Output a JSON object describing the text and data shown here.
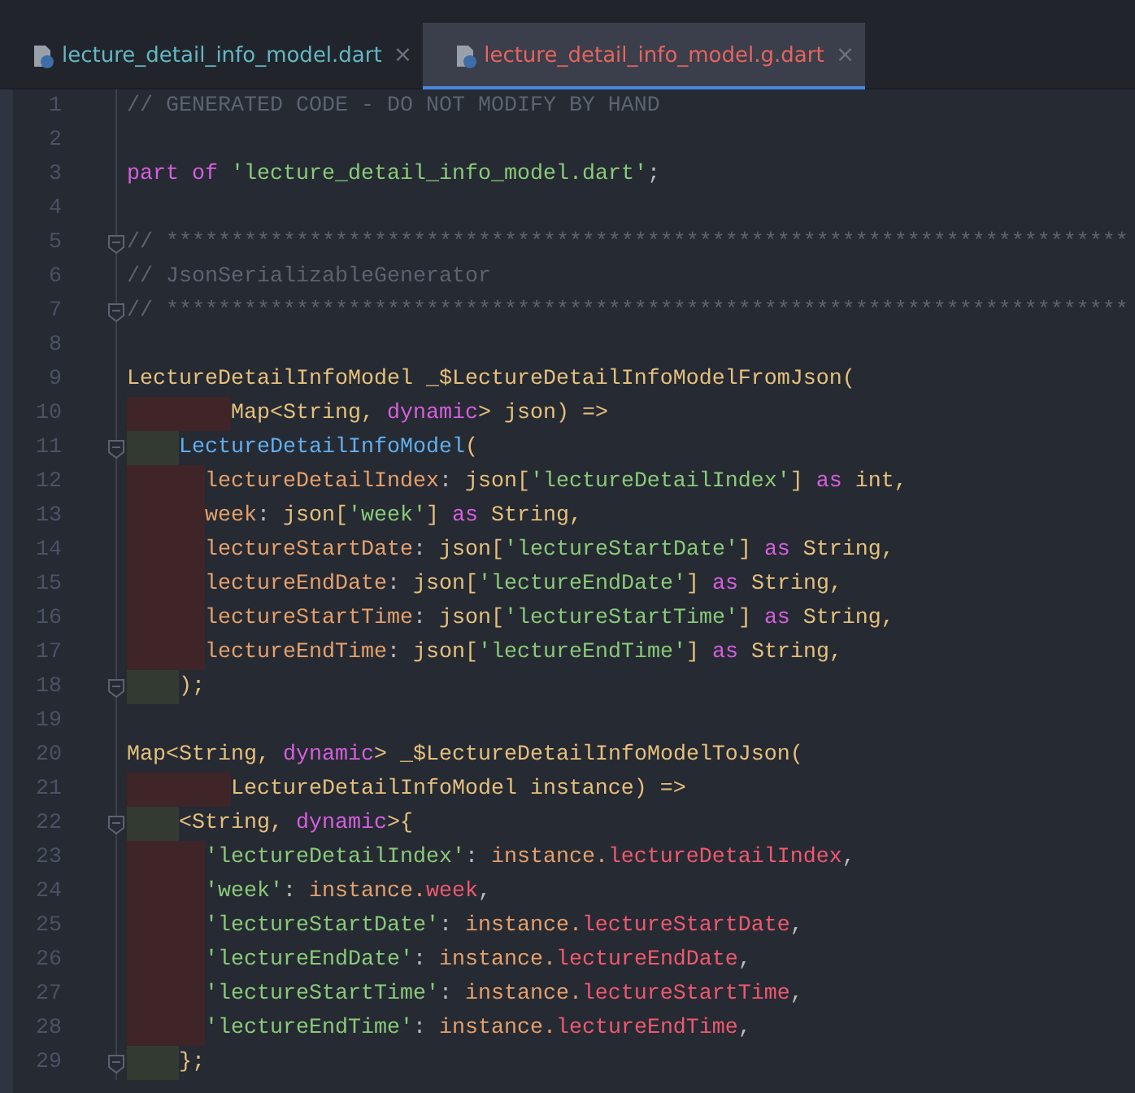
{
  "tabs": [
    {
      "label": "lecture_detail_info_model.dart",
      "close": "×",
      "selected": false,
      "color": "#62b8c4"
    },
    {
      "label": "lecture_detail_info_model.g.dart",
      "close": "×",
      "selected": true,
      "color": "#e8645e"
    }
  ],
  "editor": {
    "lines": [
      {
        "n": "1",
        "tokens": [
          {
            "kind": "comment",
            "t": "// GENERATED CODE - DO NOT MODIFY BY HAND"
          }
        ]
      },
      {
        "n": "2"
      },
      {
        "n": "3",
        "tokens": [
          {
            "kind": "keyword",
            "t": "part of "
          },
          {
            "kind": "string",
            "t": "'lecture_detail_info_model.dart'"
          },
          {
            "kind": "plain",
            "t": ";"
          }
        ]
      },
      {
        "n": "4"
      },
      {
        "n": "5",
        "fold": true,
        "tokens": [
          {
            "kind": "comment",
            "t": "// **************************************************************************"
          }
        ]
      },
      {
        "n": "6",
        "tokens": [
          {
            "kind": "comment",
            "t": "// JsonSerializableGenerator"
          }
        ]
      },
      {
        "n": "7",
        "fold": true,
        "tokens": [
          {
            "kind": "comment",
            "t": "// **************************************************************************"
          }
        ]
      },
      {
        "n": "8"
      },
      {
        "n": "9",
        "tokens": [
          {
            "kind": "type",
            "t": "LectureDetailInfoModel _$LectureDetailInfoModelFromJson("
          }
        ]
      },
      {
        "n": "10",
        "indent_error": true,
        "tokens": [
          {
            "kind": "type",
            "t": "        Map<String, "
          },
          {
            "kind": "keyword",
            "t": "dynamic"
          },
          {
            "kind": "type",
            "t": "> json) =>"
          }
        ]
      },
      {
        "n": "11",
        "indent_error": false,
        "fold": true,
        "tokens": [
          {
            "kind": "class",
            "t": "    LectureDetailInfoModel"
          },
          {
            "kind": "type",
            "t": "("
          }
        ]
      },
      {
        "n": "12",
        "indent_error": true,
        "tokens": [
          {
            "kind": "param",
            "t": "      lectureDetailIndex"
          },
          {
            "kind": "plain",
            "t": ": "
          },
          {
            "kind": "type",
            "t": "json["
          },
          {
            "kind": "string",
            "t": "'lectureDetailIndex'"
          },
          {
            "kind": "type",
            "t": "] "
          },
          {
            "kind": "keyword",
            "t": "as"
          },
          {
            "kind": "type",
            "t": " int,"
          }
        ]
      },
      {
        "n": "13",
        "indent_error": true,
        "tokens": [
          {
            "kind": "param",
            "t": "      week"
          },
          {
            "kind": "plain",
            "t": ": "
          },
          {
            "kind": "type",
            "t": "json["
          },
          {
            "kind": "string",
            "t": "'week'"
          },
          {
            "kind": "type",
            "t": "] "
          },
          {
            "kind": "keyword",
            "t": "as"
          },
          {
            "kind": "type",
            "t": " String,"
          }
        ]
      },
      {
        "n": "14",
        "indent_error": true,
        "tokens": [
          {
            "kind": "param",
            "t": "      lectureStartDate"
          },
          {
            "kind": "plain",
            "t": ": "
          },
          {
            "kind": "type",
            "t": "json["
          },
          {
            "kind": "string",
            "t": "'lectureStartDate'"
          },
          {
            "kind": "type",
            "t": "] "
          },
          {
            "kind": "keyword",
            "t": "as"
          },
          {
            "kind": "type",
            "t": " String,"
          }
        ]
      },
      {
        "n": "15",
        "indent_error": true,
        "tokens": [
          {
            "kind": "param",
            "t": "      lectureEndDate"
          },
          {
            "kind": "plain",
            "t": ": "
          },
          {
            "kind": "type",
            "t": "json["
          },
          {
            "kind": "string",
            "t": "'lectureEndDate'"
          },
          {
            "kind": "type",
            "t": "] "
          },
          {
            "kind": "keyword",
            "t": "as"
          },
          {
            "kind": "type",
            "t": " String,"
          }
        ]
      },
      {
        "n": "16",
        "indent_error": true,
        "tokens": [
          {
            "kind": "param",
            "t": "      lectureStartTime"
          },
          {
            "kind": "plain",
            "t": ": "
          },
          {
            "kind": "type",
            "t": "json["
          },
          {
            "kind": "string",
            "t": "'lectureStartTime'"
          },
          {
            "kind": "type",
            "t": "] "
          },
          {
            "kind": "keyword",
            "t": "as"
          },
          {
            "kind": "type",
            "t": " String,"
          }
        ]
      },
      {
        "n": "17",
        "indent_error": true,
        "tokens": [
          {
            "kind": "param",
            "t": "      lectureEndTime"
          },
          {
            "kind": "plain",
            "t": ": "
          },
          {
            "kind": "type",
            "t": "json["
          },
          {
            "kind": "string",
            "t": "'lectureEndTime'"
          },
          {
            "kind": "type",
            "t": "] "
          },
          {
            "kind": "keyword",
            "t": "as"
          },
          {
            "kind": "type",
            "t": " String,"
          }
        ]
      },
      {
        "n": "18",
        "indent_error": false,
        "fold": true,
        "tokens": [
          {
            "kind": "type",
            "t": "    );"
          }
        ]
      },
      {
        "n": "19"
      },
      {
        "n": "20",
        "tokens": [
          {
            "kind": "type",
            "t": "Map<String, "
          },
          {
            "kind": "keyword",
            "t": "dynamic"
          },
          {
            "kind": "type",
            "t": "> _$LectureDetailInfoModelToJson("
          }
        ]
      },
      {
        "n": "21",
        "indent_error": true,
        "tokens": [
          {
            "kind": "type",
            "t": "        LectureDetailInfoModel instance) =>"
          }
        ]
      },
      {
        "n": "22",
        "indent_error": false,
        "fold": true,
        "tokens": [
          {
            "kind": "type",
            "t": "    <String, "
          },
          {
            "kind": "keyword",
            "t": "dynamic"
          },
          {
            "kind": "type",
            "t": ">{"
          }
        ]
      },
      {
        "n": "23",
        "indent_error": true,
        "tokens": [
          {
            "kind": "string",
            "t": "      'lectureDetailIndex'"
          },
          {
            "kind": "plain",
            "t": ": "
          },
          {
            "kind": "param",
            "t": "instance."
          },
          {
            "kind": "field",
            "t": "lectureDetailIndex"
          },
          {
            "kind": "plain",
            "t": ","
          }
        ]
      },
      {
        "n": "24",
        "indent_error": true,
        "tokens": [
          {
            "kind": "string",
            "t": "      'week'"
          },
          {
            "kind": "plain",
            "t": ": "
          },
          {
            "kind": "param",
            "t": "instance."
          },
          {
            "kind": "field",
            "t": "week"
          },
          {
            "kind": "plain",
            "t": ","
          }
        ]
      },
      {
        "n": "25",
        "indent_error": true,
        "tokens": [
          {
            "kind": "string",
            "t": "      'lectureStartDate'"
          },
          {
            "kind": "plain",
            "t": ": "
          },
          {
            "kind": "param",
            "t": "instance."
          },
          {
            "kind": "field",
            "t": "lectureStartDate"
          },
          {
            "kind": "plain",
            "t": ","
          }
        ]
      },
      {
        "n": "26",
        "indent_error": true,
        "tokens": [
          {
            "kind": "string",
            "t": "      'lectureEndDate'"
          },
          {
            "kind": "plain",
            "t": ": "
          },
          {
            "kind": "param",
            "t": "instance."
          },
          {
            "kind": "field",
            "t": "lectureEndDate"
          },
          {
            "kind": "plain",
            "t": ","
          }
        ]
      },
      {
        "n": "27",
        "indent_error": true,
        "tokens": [
          {
            "kind": "string",
            "t": "      'lectureStartTime'"
          },
          {
            "kind": "plain",
            "t": ": "
          },
          {
            "kind": "param",
            "t": "instance."
          },
          {
            "kind": "field",
            "t": "lectureStartTime"
          },
          {
            "kind": "plain",
            "t": ","
          }
        ]
      },
      {
        "n": "28",
        "indent_error": true,
        "tokens": [
          {
            "kind": "string",
            "t": "      'lectureEndTime'"
          },
          {
            "kind": "plain",
            "t": ": "
          },
          {
            "kind": "param",
            "t": "instance."
          },
          {
            "kind": "field",
            "t": "lectureEndTime"
          },
          {
            "kind": "plain",
            "t": ","
          }
        ]
      },
      {
        "n": "29",
        "indent_error": false,
        "fold": true,
        "tokens": [
          {
            "kind": "type",
            "t": "    };"
          }
        ]
      }
    ]
  }
}
